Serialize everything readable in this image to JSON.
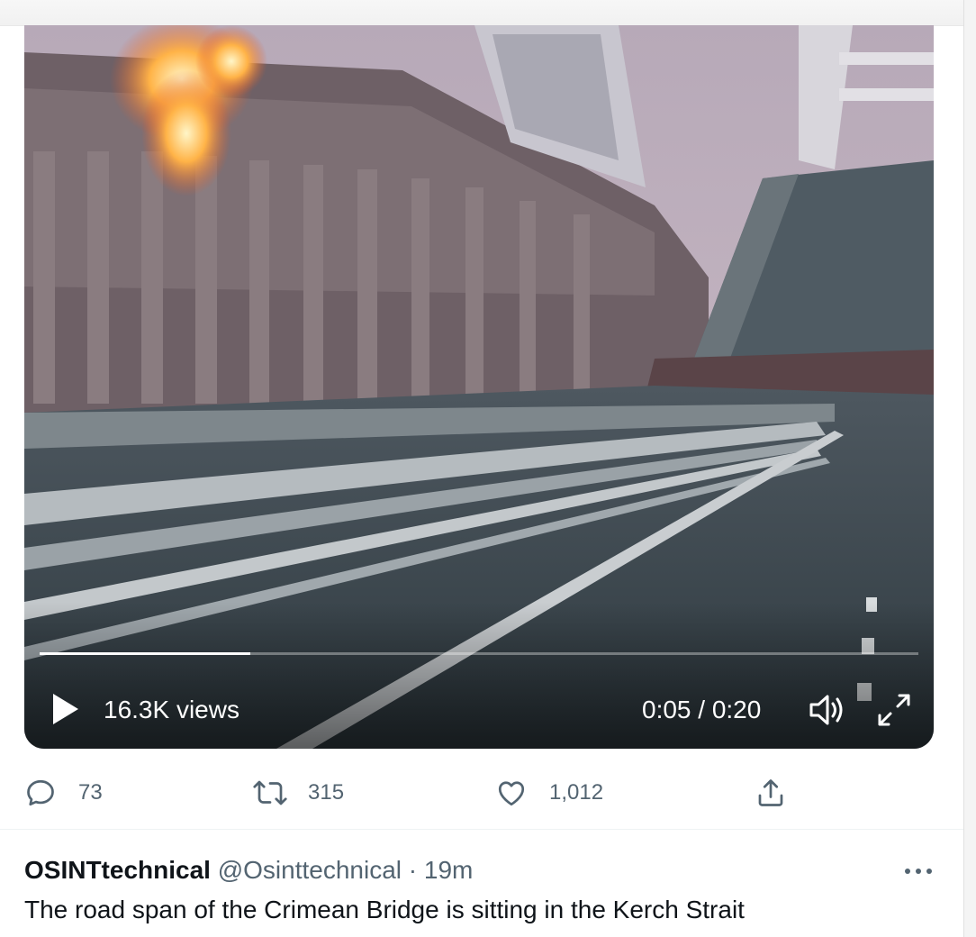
{
  "video": {
    "views": "16.3K views",
    "time": "0:05 / 0:20",
    "progress": 0.24,
    "icons": {
      "play": "play-icon",
      "volume": "volume-icon",
      "fullscreen": "fullscreen-icon"
    }
  },
  "actions": {
    "reply": {
      "icon": "reply-icon",
      "count": "73"
    },
    "retweet": {
      "icon": "retweet-icon",
      "count": "315"
    },
    "like": {
      "icon": "heart-icon",
      "count": "1,012"
    },
    "share": {
      "icon": "share-icon"
    }
  },
  "next_tweet": {
    "name": "OSINTtechnical",
    "handle": "@Osinttechnical",
    "separator": "·",
    "time_ago": "19m",
    "text": "The road span of the Crimean Bridge is sitting in the Kerch Strait",
    "more_icon": "more-icon"
  },
  "colors": {
    "text_primary": "#0f1419",
    "text_secondary": "#536471",
    "fire": "#f5a623"
  }
}
